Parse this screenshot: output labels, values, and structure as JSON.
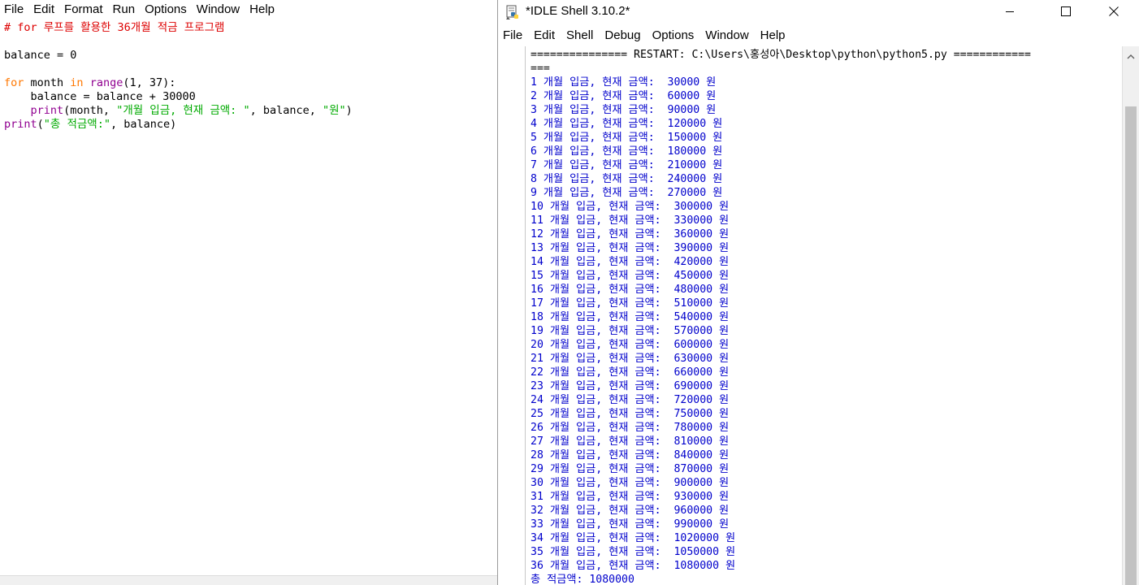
{
  "editor": {
    "menu": [
      "File",
      "Edit",
      "Format",
      "Run",
      "Options",
      "Window",
      "Help"
    ],
    "code": {
      "comment": "# for 루프를 활용한 36개월 적금 프로그램",
      "l3_a": "balance = 0",
      "l5_kw1": "for",
      "l5_a": " month ",
      "l5_kw2": "in",
      "l5_sp": " ",
      "l5_bi": "range",
      "l5_b": "(1, 37):",
      "l6_a": "    balance = balance + 30000",
      "l7_ind": "    ",
      "l7_bi": "print",
      "l7_a": "(month, ",
      "l7_s1": "\"개월 입금, 현재 금액: \"",
      "l7_b": ", balance, ",
      "l7_s2": "\"원\"",
      "l7_c": ")",
      "l8_bi": "print",
      "l8_a": "(",
      "l8_s1": "\"총 적금액:\"",
      "l8_b": ", balance)"
    }
  },
  "shell": {
    "title": "*IDLE Shell 3.10.2*",
    "menu": [
      "File",
      "Edit",
      "Shell",
      "Debug",
      "Options",
      "Window",
      "Help"
    ],
    "restart_line_1": "=============== RESTART: C:\\Users\\홍성아\\Desktop\\python\\python5.py ============",
    "restart_line_2": "===",
    "output": [
      "1 개월 입금, 현재 금액:  30000 원",
      "2 개월 입금, 현재 금액:  60000 원",
      "3 개월 입금, 현재 금액:  90000 원",
      "4 개월 입금, 현재 금액:  120000 원",
      "5 개월 입금, 현재 금액:  150000 원",
      "6 개월 입금, 현재 금액:  180000 원",
      "7 개월 입금, 현재 금액:  210000 원",
      "8 개월 입금, 현재 금액:  240000 원",
      "9 개월 입금, 현재 금액:  270000 원",
      "10 개월 입금, 현재 금액:  300000 원",
      "11 개월 입금, 현재 금액:  330000 원",
      "12 개월 입금, 현재 금액:  360000 원",
      "13 개월 입금, 현재 금액:  390000 원",
      "14 개월 입금, 현재 금액:  420000 원",
      "15 개월 입금, 현재 금액:  450000 원",
      "16 개월 입금, 현재 금액:  480000 원",
      "17 개월 입금, 현재 금액:  510000 원",
      "18 개월 입금, 현재 금액:  540000 원",
      "19 개월 입금, 현재 금액:  570000 원",
      "20 개월 입금, 현재 금액:  600000 원",
      "21 개월 입금, 현재 금액:  630000 원",
      "22 개월 입금, 현재 금액:  660000 원",
      "23 개월 입금, 현재 금액:  690000 원",
      "24 개월 입금, 현재 금액:  720000 원",
      "25 개월 입금, 현재 금액:  750000 원",
      "26 개월 입금, 현재 금액:  780000 원",
      "27 개월 입금, 현재 금액:  810000 원",
      "28 개월 입금, 현재 금액:  840000 원",
      "29 개월 입금, 현재 금액:  870000 원",
      "30 개월 입금, 현재 금액:  900000 원",
      "31 개월 입금, 현재 금액:  930000 원",
      "32 개월 입금, 현재 금액:  960000 원",
      "33 개월 입금, 현재 금액:  990000 원",
      "34 개월 입금, 현재 금액:  1020000 원",
      "35 개월 입금, 현재 금액:  1050000 원",
      "36 개월 입금, 현재 금액:  1080000 원",
      "총 적금액: 1080000"
    ]
  },
  "icons": {
    "app": "idle-python-icon",
    "minimize": "minimize-icon",
    "maximize": "maximize-icon",
    "close": "close-icon",
    "scroll_up": "chevron-up-icon"
  },
  "colors": {
    "keyword": "#ff7700",
    "builtin": "#900090",
    "string": "#00aa00",
    "comment": "#dd0000",
    "shell_output": "#0000cc"
  }
}
